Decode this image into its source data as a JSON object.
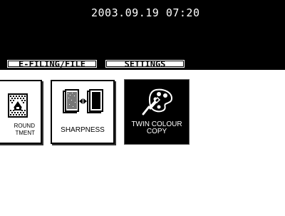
{
  "header": {
    "datetime": "2003.09.19 07:20"
  },
  "tabs": [
    {
      "label": "E-FILING/FILE"
    },
    {
      "label": "SETTINGS"
    }
  ],
  "functions": [
    {
      "label": "ROUND\nTMENT",
      "icon": "background-adjustment-icon"
    },
    {
      "label": "SHARPNESS",
      "icon": "sharpness-icon"
    },
    {
      "label": "TWIN COLOUR\nCOPY",
      "icon": "twin-colour-icon"
    }
  ]
}
